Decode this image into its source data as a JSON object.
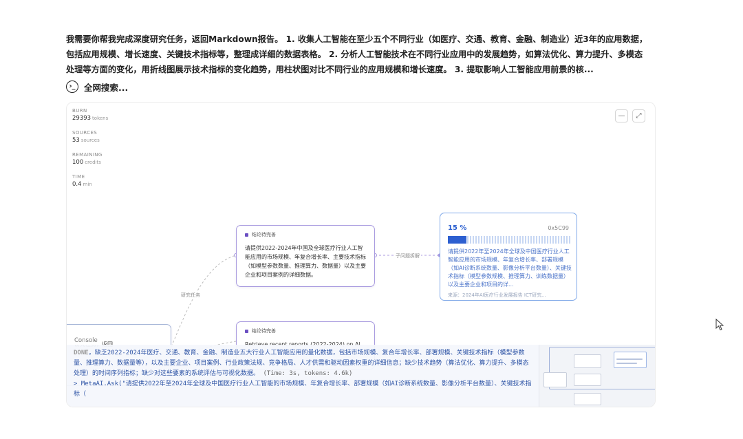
{
  "query": {
    "text": "我需要你帮我完成深度研究任务，返回Markdown报告。 1. 收集人工智能在至少五个不同行业（如医疗、交通、教育、金融、制造业）近3年的应用数据，包括应用规模、增长速度、关键技术指标等，整理成详细的数据表格。 2. 分析人工智能技术在不同行业应用中的发展趋势，如算法优化、算力提升、多模态处理等方面的变化，用折线图展示技术指标的变化趋势，用柱状图对比不同行业的应用规模和增长速度。 3. 提取影响人工智能应用前景的核..."
  },
  "search_status": {
    "label": "全网搜索...",
    "icon": "terminal-icon"
  },
  "stats": [
    {
      "label": "BURN",
      "value": "29393",
      "unit": "tokens"
    },
    {
      "label": "SOURCES",
      "value": "53",
      "unit": "sources"
    },
    {
      "label": "REMAINING",
      "value": "100",
      "unit": "credits"
    },
    {
      "label": "TIME",
      "value": "0.4",
      "unit": "min"
    }
  ],
  "graph": {
    "node_a": {
      "badge": "结论待完善",
      "text": "请提供2022-2024年中国及全球医疗行业人工智能应用的市场规模、年复合增长率、主要技术指标（如模型参数数量、推理算力、数据量）以及主要企业和项目案例的详细数据。"
    },
    "node_b": {
      "badge": "结论待完善",
      "text": "Retrieve recent reports (2022-2024) on AI"
    },
    "left_node": {
      "text": "研究任务，返回"
    },
    "edge_task_label": "研究任务",
    "edge_subquery_label": "子问题拆解",
    "result": {
      "percent": "15 %",
      "progress": 0.15,
      "hash": "0x5C99",
      "text": "请提供2022年至2024年全球及中国医疗行业人工智能应用的市场规模、年复合增长率、部署规模（如AI诊断系统数量、影像分析平台数量）、关键技术指标（模型参数规模、推理算力、训练数据量）以及主要企业和项目的详...",
      "footer": "来源：2024年AI医疗行业发展报告 ICT研究..."
    }
  },
  "console": {
    "tab_label": "Console",
    "line1_status": "DONE",
    "line1_text": "，缺乏2022-2024年医疗、交通、教育、金融、制造业五大行业人工智能应用的量化数据，包括市场规模、复合年增长率、部署规模、关键技术指标（模型参数量、推理算力、数据量等），以及主要企业、项目案例、行业政策法规、竞争格局、人才供需和驱动因素权重的详细信息；缺少技术趋势（算法优化、算力提升、多模态处理）的时间序列指标；缺少对这些要素的系统评估与可视化数据。",
    "line1_meta": "(Time: 3s, tokens: 4.6k)",
    "line2_text": "> MetaAI.Ask(\"请提供2022年至2024年全球及中国医疗行业人工智能的市场规模、年复合增长率、部署规模（如AI诊断系统数量、影像分析平台数量）、关键技术指标（"
  }
}
